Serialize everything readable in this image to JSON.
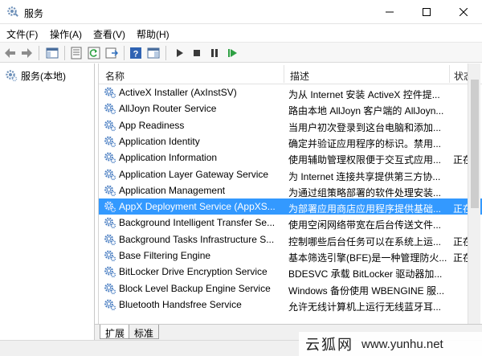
{
  "window": {
    "title": "服务",
    "icon": "services-gear-icon"
  },
  "menu": [
    "文件(F)",
    "操作(A)",
    "查看(V)",
    "帮助(H)"
  ],
  "toolbar": {
    "buttons": [
      "back-icon",
      "forward-icon",
      "show-tree-icon",
      "properties-icon",
      "refresh-icon",
      "export-list-icon",
      "help-icon",
      "mmc-icon",
      "start-service-icon",
      "stop-service-icon",
      "pause-service-icon",
      "resume-service-icon"
    ]
  },
  "tree": {
    "root_label": "服务(本地)"
  },
  "list": {
    "columns": [
      "名称",
      "描述",
      "状态"
    ],
    "rows": [
      {
        "name": "ActiveX Installer (AxInstSV)",
        "desc": "为从 Internet 安装 ActiveX 控件提...",
        "status": ""
      },
      {
        "name": "AllJoyn Router Service",
        "desc": "路由本地 AllJoyn 客户端的 AllJoyn...",
        "status": ""
      },
      {
        "name": "App Readiness",
        "desc": "当用户初次登录到这台电脑和添加...",
        "status": ""
      },
      {
        "name": "Application Identity",
        "desc": "确定并验证应用程序的标识。禁用...",
        "status": ""
      },
      {
        "name": "Application Information",
        "desc": "使用辅助管理权限便于交互式应用...",
        "status": "正在"
      },
      {
        "name": "Application Layer Gateway Service",
        "desc": "为 Internet 连接共享提供第三方协...",
        "status": ""
      },
      {
        "name": "Application Management",
        "desc": "为通过组策略部署的软件处理安装...",
        "status": ""
      },
      {
        "name": "AppX Deployment Service (AppXS...",
        "desc": "为部署应用商店应用程序提供基础...",
        "status": "正在",
        "selected": true
      },
      {
        "name": "Background Intelligent Transfer Se...",
        "desc": "使用空闲网络带宽在后台传送文件...",
        "status": ""
      },
      {
        "name": "Background Tasks Infrastructure S...",
        "desc": "控制哪些后台任务可以在系统上运...",
        "status": "正在"
      },
      {
        "name": "Base Filtering Engine",
        "desc": "基本筛选引擎(BFE)是一种管理防火...",
        "status": "正在"
      },
      {
        "name": "BitLocker Drive Encryption Service",
        "desc": "BDESVC 承载 BitLocker 驱动器加...",
        "status": ""
      },
      {
        "name": "Block Level Backup Engine Service",
        "desc": "Windows 备份使用 WBENGINE 服...",
        "status": ""
      },
      {
        "name": "Bluetooth Handsfree Service",
        "desc": "允许无线计算机上运行无线蓝牙耳...",
        "status": ""
      }
    ]
  },
  "tabs": [
    "扩展",
    "标准"
  ],
  "watermark": {
    "text_cn": "云狐网",
    "url": "www.yunhu.net"
  },
  "colors": {
    "selection": "#3399ff",
    "gear_blue": "#4a7ec2",
    "play_green": "#2ea043"
  }
}
